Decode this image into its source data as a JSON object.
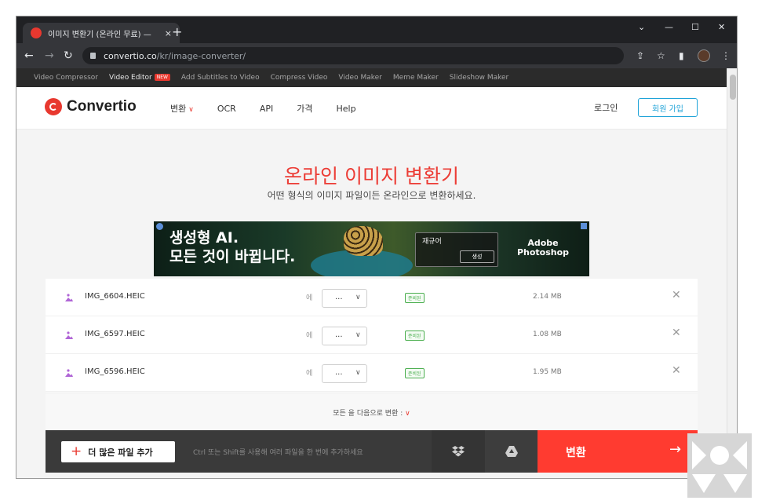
{
  "browser": {
    "tab_title": "이미지 변환기 (온라인 무료) —",
    "tab_close": "×",
    "new_tab": "+",
    "url_host": "convertio.co",
    "url_path": "/kr/image-converter/",
    "controls": {
      "chevron": "⌄",
      "minimize": "—",
      "maximize": "☐",
      "close": "✕"
    }
  },
  "promo_bar": {
    "items": [
      "Video Compressor",
      "Video Editor",
      "Add Subtitles to Video",
      "Compress Video",
      "Video Maker",
      "Meme Maker",
      "Slideshow Maker"
    ],
    "new_badge": "NEW"
  },
  "header": {
    "logo": "Convertio",
    "nav": [
      "변환",
      "OCR",
      "API",
      "가격",
      "Help"
    ],
    "login": "로그인",
    "signup": "회원 가입"
  },
  "hero": {
    "title": "온라인 이미지 변환기",
    "subtitle": "어떤 형식의 이미지 파일이든 온라인으로 변환하세요."
  },
  "ad": {
    "headline_1": "생성형 AI.",
    "headline_2": "모든 것이 바뀝니다.",
    "prompt_label": "재규어",
    "generate_button": "생성",
    "brand_1": "Adobe",
    "brand_2": "Photoshop"
  },
  "files": [
    {
      "name": "IMG_6604.HEIC",
      "to": "에",
      "format": "...",
      "status": "준비된",
      "size": "2.14 MB"
    },
    {
      "name": "IMG_6597.HEIC",
      "to": "에",
      "format": "...",
      "status": "준비된",
      "size": "1.08 MB"
    },
    {
      "name": "IMG_6596.HEIC",
      "to": "에",
      "format": "...",
      "status": "준비된",
      "size": "1.95 MB"
    }
  ],
  "bulk": {
    "label": "모든 을 다음으로 변환 :"
  },
  "actions": {
    "add_more": "더 많은 파일 추가",
    "hint": "Ctrl 또는 Shift를 사용해 여러 파일을 한 번에 추가하세요",
    "convert": "변환"
  },
  "colors": {
    "accent": "#ff3b30",
    "brand_red": "#e8382f",
    "link_blue": "#1fa3d8",
    "ready_green": "#4caf50"
  },
  "icons": {
    "file": "image-file-icon",
    "remove": "close-icon",
    "dropbox": "dropbox-icon",
    "drive": "google-drive-icon",
    "arrow": "arrow-right-icon"
  }
}
